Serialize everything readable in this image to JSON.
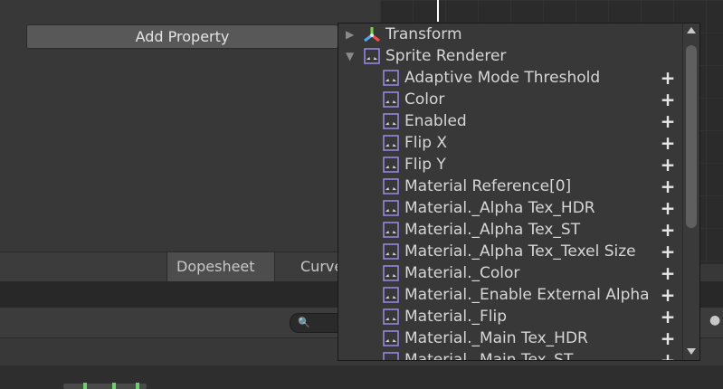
{
  "toolbar": {
    "add_property_label": "Add Property"
  },
  "tabs": [
    {
      "label": "Dopesheet"
    },
    {
      "label": "Curves"
    }
  ],
  "search": {
    "icon": "search-icon"
  },
  "popup": {
    "groups": [
      {
        "label": "Transform",
        "icon": "transform-icon",
        "expanded": false
      },
      {
        "label": "Sprite Renderer",
        "icon": "sprite-renderer-icon",
        "expanded": true
      }
    ],
    "properties": [
      {
        "label": "Adaptive Mode Threshold"
      },
      {
        "label": "Color"
      },
      {
        "label": "Enabled"
      },
      {
        "label": "Flip X"
      },
      {
        "label": "Flip Y"
      },
      {
        "label": "Material Reference[0]"
      },
      {
        "label": "Material._Alpha Tex_HDR"
      },
      {
        "label": "Material._Alpha Tex_ST"
      },
      {
        "label": "Material._Alpha Tex_Texel Size"
      },
      {
        "label": "Material._Color"
      },
      {
        "label": "Material._Enable External Alpha"
      },
      {
        "label": "Material._Flip"
      },
      {
        "label": "Material._Main Tex_HDR"
      },
      {
        "label": "Material._Main Tex_ST"
      }
    ],
    "add_icon": "plus-icon",
    "property_icon": "sprite-renderer-icon"
  },
  "colors": {
    "panel_bg": "#383838",
    "popup_border": "#191919",
    "text": "#d6d6d6",
    "sprite_icon_accent": "#8f7fe0"
  }
}
